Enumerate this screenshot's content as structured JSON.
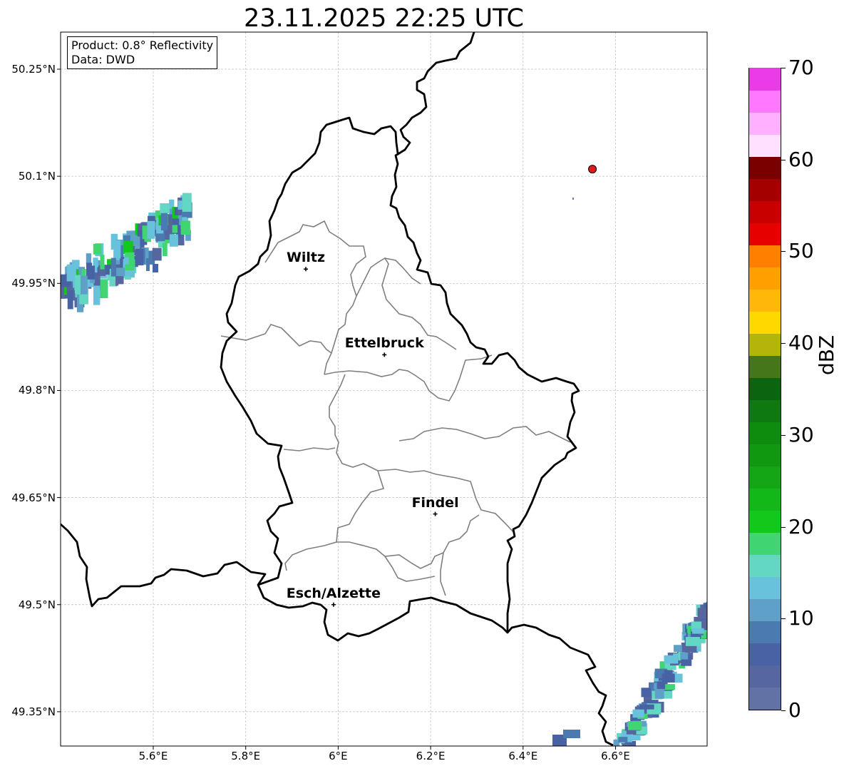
{
  "title": "23.11.2025 22:25 UTC",
  "infobox": {
    "product": "Product: 0.8° Reflectivity",
    "source": "Data: DWD"
  },
  "axes": {
    "lat_labels": [
      "50.25°N",
      "50.1°N",
      "49.95°N",
      "49.8°N",
      "49.65°N",
      "49.5°N",
      "49.35°N"
    ],
    "lon_labels": [
      "5.6°E",
      "5.8°E",
      "6°E",
      "6.2°E",
      "6.4°E",
      "6.6°E"
    ],
    "grid": true
  },
  "cities": [
    {
      "name": "Wiltz",
      "lon": 5.93,
      "lat": 49.97
    },
    {
      "name": "Ettelbruck",
      "lon": 6.1,
      "lat": 49.85
    },
    {
      "name": "Findel",
      "lon": 6.21,
      "lat": 49.627
    },
    {
      "name": "Esch/Alzette",
      "lon": 5.99,
      "lat": 49.5
    }
  ],
  "radar_marker": {
    "lon": 6.55,
    "lat": 50.11,
    "color": "#e31a1c"
  },
  "colorbar": {
    "unit": "dBZ",
    "ticks": [
      "0",
      "10",
      "20",
      "30",
      "40",
      "50",
      "60",
      "70"
    ],
    "min": 0,
    "max": 70,
    "step": 2.5,
    "colors": [
      "#6272a4",
      "#56669e",
      "#4862a4",
      "#4a7ab0",
      "#5fa0c8",
      "#68c2dc",
      "#64d6c4",
      "#40d473",
      "#12c81a",
      "#12b818",
      "#14a614",
      "#109810",
      "#0e8c0e",
      "#0d7910",
      "#0a6410",
      "#46761a",
      "#b4b50a",
      "#ffd800",
      "#ffb80a",
      "#ffa000",
      "#ff8000",
      "#e60000",
      "#c80000",
      "#a40000",
      "#7a0000",
      "#ffe0ff",
      "#ffb0ff",
      "#ff78ff",
      "#eb3ae8"
    ]
  }
}
